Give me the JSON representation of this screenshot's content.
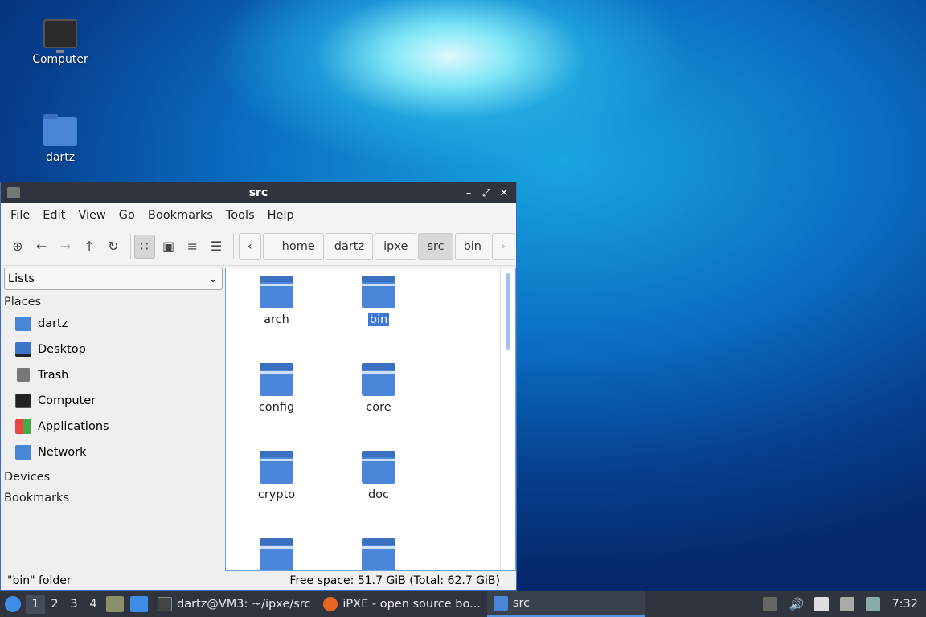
{
  "desktop": {
    "icons": [
      {
        "label": "Computer"
      },
      {
        "label": "dartz"
      }
    ]
  },
  "window": {
    "title": "src",
    "controls": {
      "minimize": "–",
      "maximize": "⤢",
      "close": "✕"
    },
    "menu": [
      "File",
      "Edit",
      "View",
      "Go",
      "Bookmarks",
      "Tools",
      "Help"
    ],
    "toolbar": {
      "new_tab": "⊕",
      "back": "←",
      "forward": "→",
      "up": "↑",
      "reload": "↻",
      "icon_view": "∷",
      "thumb_view": "▣",
      "compact_view": "≡",
      "detail_view": "☰"
    },
    "path": {
      "prev": "‹",
      "next": "›",
      "crumbs": [
        "home",
        "dartz",
        "ipxe",
        "src",
        "bin"
      ],
      "active_index": 3
    },
    "sidebar": {
      "selector": "Lists",
      "places_header": "Places",
      "places": [
        "dartz",
        "Desktop",
        "Trash",
        "Computer",
        "Applications",
        "Network"
      ],
      "devices_header": "Devices",
      "bookmarks_header": "Bookmarks"
    },
    "files": [
      {
        "name": "arch",
        "selected": false
      },
      {
        "name": "bin",
        "selected": true
      },
      {
        "name": "config",
        "selected": false
      },
      {
        "name": "core",
        "selected": false
      },
      {
        "name": "crypto",
        "selected": false
      },
      {
        "name": "doc",
        "selected": false
      },
      {
        "name": "",
        "selected": false
      },
      {
        "name": "",
        "selected": false
      }
    ],
    "status": {
      "left": "\"bin\" folder",
      "right": "Free space: 51.7 GiB (Total: 62.7 GiB)"
    }
  },
  "taskbar": {
    "workspaces": [
      "1",
      "2",
      "3",
      "4"
    ],
    "active_workspace": "1",
    "tasks": [
      {
        "label": "dartz@VM3: ~/ipxe/src",
        "icon": "terminal-icon"
      },
      {
        "label": "iPXE - open source bo...",
        "icon": "firefox-icon"
      },
      {
        "label": "src",
        "icon": "folder-icon"
      }
    ],
    "clock": "7:32"
  }
}
